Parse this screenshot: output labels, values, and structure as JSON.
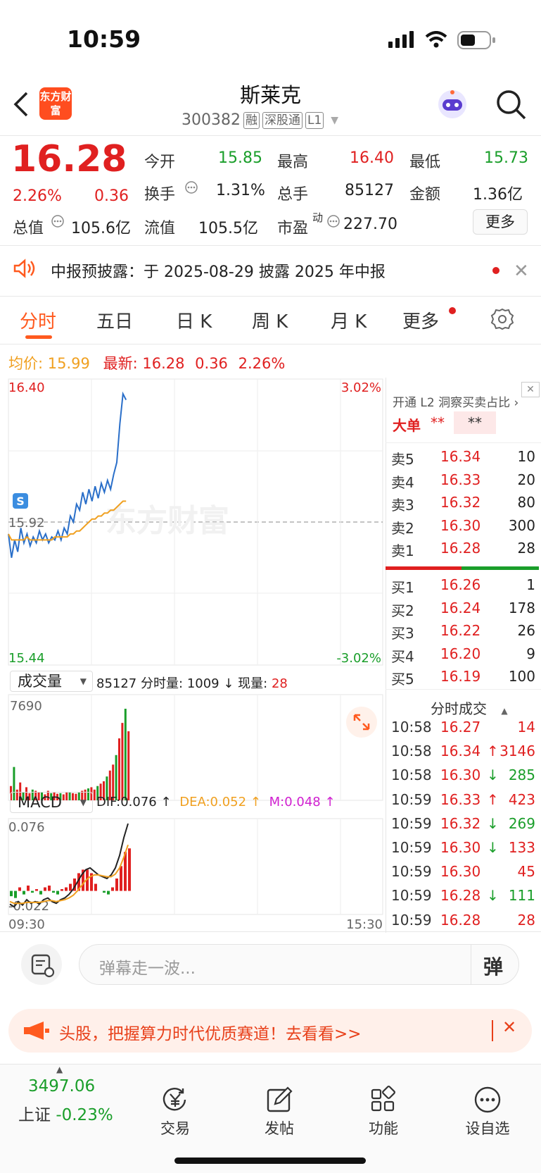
{
  "status_bar": {
    "time": "10:59"
  },
  "header": {
    "logo_text": "东方财富",
    "title": "斯莱克",
    "code": "300382",
    "tags": [
      "融",
      "深股通",
      "L1"
    ]
  },
  "quote": {
    "price": "16.28",
    "change_pct": "2.26%",
    "change": "0.36",
    "open_label": "今开",
    "open": "15.85",
    "high_label": "最高",
    "high": "16.40",
    "low_label": "最低",
    "low": "15.73",
    "turnover_label": "换手",
    "turnover": "1.31%",
    "volume_label": "总手",
    "volume": "85127",
    "amount_label": "金额",
    "amount": "1.36亿",
    "mktcap_label": "总值",
    "mktcap": "105.6亿",
    "float_label": "流值",
    "float": "105.5亿",
    "pe_label": "市盈",
    "pe_sup": "动",
    "pe": "227.70",
    "more_button": "更多"
  },
  "notice": {
    "text": "中报预披露：于 2025-08-29 披露 2025 年中报"
  },
  "tabs": [
    {
      "label": "分时",
      "active": true
    },
    {
      "label": "五日"
    },
    {
      "label": "日 K"
    },
    {
      "label": "周 K"
    },
    {
      "label": "月 K"
    },
    {
      "label": "更多"
    }
  ],
  "info_line": {
    "avg_label": "均价:",
    "avg": "15.99",
    "latest_label": "最新:",
    "latest": "16.28",
    "chg": "0.36",
    "chg_pct": "2.26%"
  },
  "chart_data": [
    {
      "type": "line",
      "x_start": "09:30",
      "x_end": "15:30",
      "ylim": [
        15.44,
        16.4
      ],
      "y_top_label": "16.40",
      "y_mid_label": "15.92",
      "y_bottom_label": "15.44",
      "pct_top_label": "3.02%",
      "pct_bottom_label": "-3.02%",
      "watermark": "东方财富",
      "series": [
        {
          "values": [
            15.88,
            15.8,
            15.86,
            15.82,
            15.9,
            15.85,
            15.88,
            15.84,
            15.87,
            15.85,
            15.89,
            15.86,
            15.88,
            15.85,
            15.87,
            15.86,
            15.89,
            15.86,
            15.9,
            15.88,
            15.94,
            15.92,
            15.98,
            15.96,
            16.02,
            15.98,
            16.03,
            15.99,
            16.04,
            16.0,
            16.05,
            16.02,
            16.06,
            16.03,
            16.08,
            16.12,
            16.25,
            16.35,
            16.33
          ]
        },
        {
          "values": [
            15.88,
            15.86,
            15.86,
            15.86,
            15.86,
            15.86,
            15.87,
            15.86,
            15.86,
            15.86,
            15.86,
            15.86,
            15.86,
            15.86,
            15.86,
            15.87,
            15.87,
            15.87,
            15.87,
            15.87,
            15.88,
            15.88,
            15.89,
            15.89,
            15.9,
            15.91,
            15.92,
            15.93,
            15.93,
            15.94,
            15.94,
            15.95,
            15.95,
            15.96,
            15.96,
            15.97,
            15.98,
            15.99,
            15.99
          ]
        }
      ]
    },
    {
      "type": "bar",
      "label": "成交量",
      "total": "85127",
      "period_label": "分时量:",
      "period": "1009",
      "now_label": "现量:",
      "now": "28",
      "ymax_label": "7690",
      "values": [
        1200,
        2800,
        900,
        1500,
        700,
        1100,
        600,
        900,
        800,
        700,
        650,
        500,
        800,
        600,
        700,
        550,
        600,
        500,
        700,
        650,
        600,
        550,
        700,
        800,
        900,
        1000,
        1100,
        900,
        1200,
        1400,
        1600,
        2000,
        2500,
        3000,
        3800,
        5200,
        6500,
        7690,
        5800
      ]
    },
    {
      "type": "line",
      "label": "MACD",
      "dif_label": "DIF:0.076",
      "dea_label": "DEA:0.052",
      "m_label": "M:0.048",
      "y_top_label": "0.076",
      "y_bottom_label": "-0.022",
      "series": [
        {
          "name": "DIF",
          "values": [
            -0.015,
            -0.018,
            -0.012,
            -0.016,
            -0.01,
            -0.014,
            -0.012,
            -0.015,
            -0.01,
            -0.008,
            -0.012,
            -0.014,
            -0.01,
            -0.008,
            -0.004,
            0.002,
            0.01,
            0.018,
            0.024,
            0.026,
            0.022,
            0.018,
            0.016,
            0.014,
            0.018,
            0.026,
            0.04,
            0.06,
            0.076
          ]
        },
        {
          "name": "DEA",
          "values": [
            -0.012,
            -0.014,
            -0.014,
            -0.014,
            -0.013,
            -0.013,
            -0.013,
            -0.013,
            -0.012,
            -0.011,
            -0.011,
            -0.012,
            -0.011,
            -0.01,
            -0.008,
            -0.005,
            0.0,
            0.006,
            0.012,
            0.016,
            0.018,
            0.018,
            0.017,
            0.016,
            0.016,
            0.019,
            0.026,
            0.038,
            0.052
          ]
        },
        {
          "name": "M",
          "values": [
            -0.006,
            -0.008,
            0.004,
            -0.004,
            0.006,
            -0.002,
            0.002,
            -0.004,
            0.004,
            0.006,
            -0.002,
            -0.004,
            0.002,
            0.004,
            0.008,
            0.014,
            0.02,
            0.024,
            0.024,
            0.02,
            0.008,
            0.0,
            -0.002,
            -0.004,
            0.004,
            0.014,
            0.028,
            0.044,
            0.048
          ]
        }
      ]
    }
  ],
  "orderbook": {
    "l2_text": "开通 L2 洞察买卖占比",
    "big_label": "大单",
    "big_val1": "**",
    "big_val2": "**",
    "asks": [
      {
        "label": "卖5",
        "price": "16.34",
        "vol": "10"
      },
      {
        "label": "卖4",
        "price": "16.33",
        "vol": "20"
      },
      {
        "label": "卖3",
        "price": "16.32",
        "vol": "80"
      },
      {
        "label": "卖2",
        "price": "16.30",
        "vol": "300"
      },
      {
        "label": "卖1",
        "price": "16.28",
        "vol": "28"
      }
    ],
    "bids": [
      {
        "label": "买1",
        "price": "16.26",
        "vol": "1"
      },
      {
        "label": "买2",
        "price": "16.24",
        "vol": "178"
      },
      {
        "label": "买3",
        "price": "16.22",
        "vol": "26"
      },
      {
        "label": "买4",
        "price": "16.20",
        "vol": "9"
      },
      {
        "label": "买5",
        "price": "16.19",
        "vol": "100"
      }
    ]
  },
  "ticks": {
    "title": "分时成交",
    "rows": [
      {
        "time": "10:58",
        "price": "16.27",
        "arrow": "",
        "vol": "14",
        "color": "red"
      },
      {
        "time": "10:58",
        "price": "16.34",
        "arrow": "↑",
        "vol": "3146",
        "color": "red"
      },
      {
        "time": "10:58",
        "price": "16.30",
        "arrow": "↓",
        "vol": "285",
        "color": "green"
      },
      {
        "time": "10:59",
        "price": "16.33",
        "arrow": "↑",
        "vol": "423",
        "color": "red"
      },
      {
        "time": "10:59",
        "price": "16.32",
        "arrow": "↓",
        "vol": "269",
        "color": "green"
      },
      {
        "time": "10:59",
        "price": "16.30",
        "arrow": "↓",
        "vol": "133",
        "color": "red"
      },
      {
        "time": "10:59",
        "price": "16.30",
        "arrow": "",
        "vol": "45",
        "color": "red"
      },
      {
        "time": "10:59",
        "price": "16.28",
        "arrow": "↓",
        "vol": "111",
        "color": "green"
      },
      {
        "time": "10:59",
        "price": "16.28",
        "arrow": "",
        "vol": "28",
        "color": "red"
      }
    ]
  },
  "comment": {
    "placeholder": "弹幕走一波...",
    "danmu_button": "弹"
  },
  "banner": {
    "text": "头股，把握算力时代优质赛道！去看看>>"
  },
  "bottom_nav": {
    "index_value": "3497.06",
    "index_name": "上证",
    "index_change": "-0.23%",
    "items": [
      {
        "label": "交易",
        "icon": "yen-icon"
      },
      {
        "label": "发帖",
        "icon": "edit-icon"
      },
      {
        "label": "功能",
        "icon": "grid-icon"
      },
      {
        "label": "设自选",
        "icon": "more-icon"
      }
    ]
  },
  "colors": {
    "up": "#e02020",
    "down": "#1a9e2a",
    "accent": "#ff5a1f",
    "avg_line": "#f0a020",
    "price_line": "#2a6fc9"
  }
}
